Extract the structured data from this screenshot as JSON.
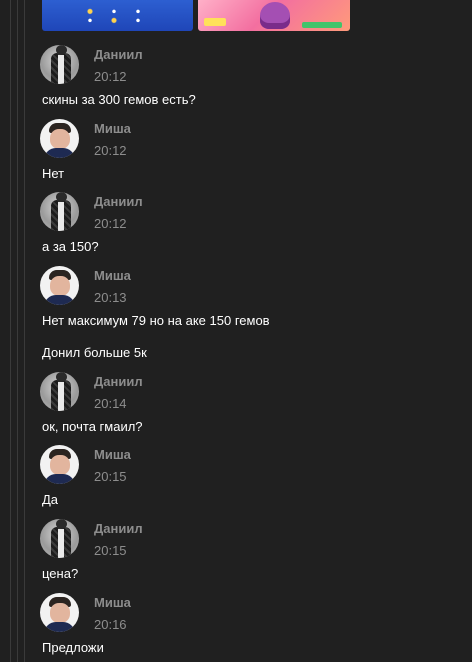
{
  "attachments": [
    {
      "kind": "game-screenshot-blue"
    },
    {
      "kind": "game-screenshot-pink"
    }
  ],
  "messages": [
    {
      "author": "Даниил",
      "time": "20:12",
      "lines": [
        "скины за 300 гемов есть?"
      ],
      "avatar": "daniil-avatar"
    },
    {
      "author": "Миша",
      "time": "20:12",
      "lines": [
        "Нет"
      ],
      "avatar": "misha-avatar"
    },
    {
      "author": "Даниил",
      "time": "20:12",
      "lines": [
        "а за 150?"
      ],
      "avatar": "daniil-avatar"
    },
    {
      "author": "Миша",
      "time": "20:13",
      "lines": [
        "Нет максимум 79 но на аке 150 гемов",
        "Донил больше 5к"
      ],
      "avatar": "misha-avatar"
    },
    {
      "author": "Даниил",
      "time": "20:14",
      "lines": [
        "ок, почта гмаил?"
      ],
      "avatar": "daniil-avatar"
    },
    {
      "author": "Миша",
      "time": "20:15",
      "lines": [
        "Да"
      ],
      "avatar": "misha-avatar"
    },
    {
      "author": "Даниил",
      "time": "20:15",
      "lines": [
        "цена?"
      ],
      "avatar": "daniil-avatar"
    },
    {
      "author": "Миша",
      "time": "20:16",
      "lines": [
        "Предложи"
      ],
      "avatar": "misha-avatar"
    }
  ],
  "colors": {
    "background": "#202020",
    "meta_text": "#8d8d8d",
    "message_text": "#ffffff"
  }
}
